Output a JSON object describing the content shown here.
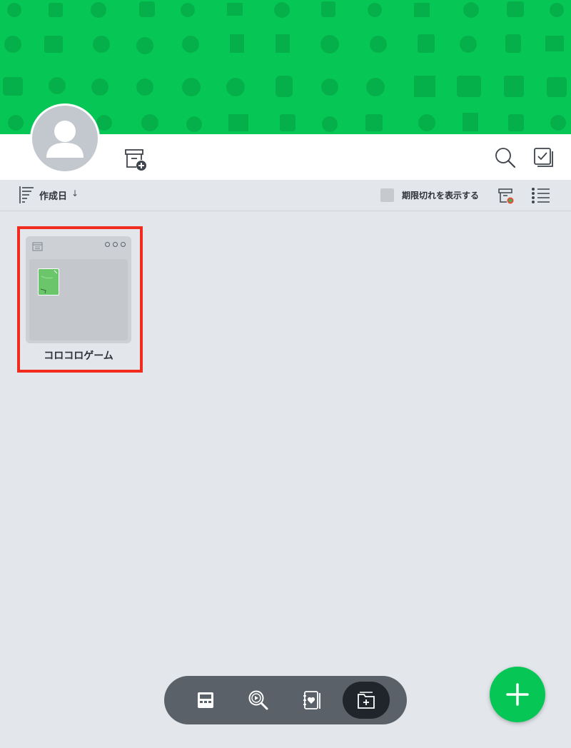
{
  "toolbar": {
    "sort_label": "作成日",
    "sort_direction": "↓",
    "expired_label": "期限切れを表示する",
    "expired_checked": false
  },
  "albums": [
    {
      "title": "コロコロゲーム"
    }
  ],
  "icons": {
    "archive_add": "archive-add-icon",
    "search": "search-icon",
    "select": "checkbox-select-icon",
    "sort": "sort-lines-icon",
    "archive": "archive-icon",
    "list": "list-view-icon",
    "fab": "plus-icon"
  },
  "colors": {
    "brand": "#06c755",
    "background": "#e3e6eb",
    "nav": "#5a6168",
    "nav_active": "#1f252b",
    "highlight": "#f12b1e"
  }
}
